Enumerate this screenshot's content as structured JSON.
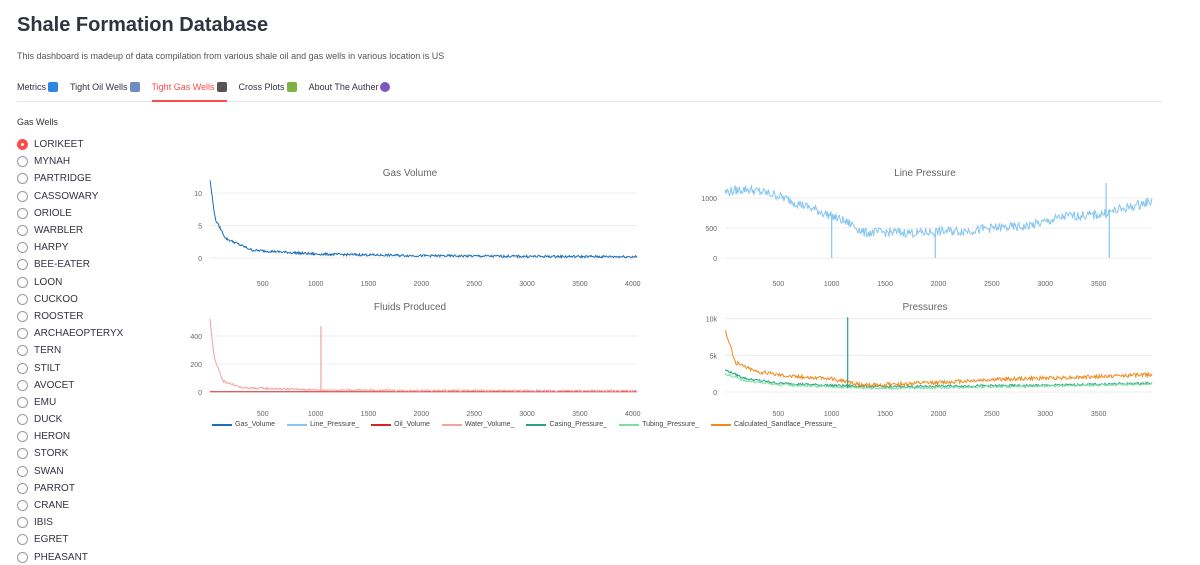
{
  "header": {
    "title": "Shale Formation Database",
    "description": "This dashboard is madeup of data compilation from various shale oil and gas wells in various location is US"
  },
  "tabs": [
    {
      "label": "Metrics",
      "icon": "chart-emoji-icon",
      "color": "#2e86de",
      "active": false
    },
    {
      "label": "Tight Oil Wells",
      "icon": "chart-down-emoji-icon",
      "color": "#6c8ebf",
      "active": false
    },
    {
      "label": "Tight Gas Wells",
      "icon": "calendar-emoji-icon",
      "color": "#555555",
      "active": true
    },
    {
      "label": "Cross Plots",
      "icon": "map-emoji-icon",
      "color": "#7cb342",
      "active": false
    },
    {
      "label": "About The Auther",
      "icon": "globe-emoji-icon",
      "color": "#7e57c2",
      "active": false
    }
  ],
  "wells": {
    "label": "Gas Wells",
    "selected": "LORIKEET",
    "options": [
      "LORIKEET",
      "MYNAH",
      "PARTRIDGE",
      "CASSOWARY",
      "ORIOLE",
      "WARBLER",
      "HARPY",
      "BEE-EATER",
      "LOON",
      "CUCKOO",
      "ROOSTER",
      "ARCHAEOPTERYX",
      "TERN",
      "STILT",
      "AVOCET",
      "EMU",
      "DUCK",
      "HERON",
      "STORK",
      "SWAN",
      "PARROT",
      "CRANE",
      "IBIS",
      "EGRET",
      "PHEASANT"
    ]
  },
  "chart_data": [
    {
      "type": "line",
      "title": "Gas Volume",
      "xlim": [
        1,
        4040
      ],
      "ylim": [
        0,
        12
      ],
      "xticks": [
        500,
        1000,
        1500,
        2000,
        2500,
        3000,
        3500,
        4000
      ],
      "yticks": [
        0,
        5,
        10
      ],
      "series": [
        {
          "name": "Gas_Volume",
          "color": "#1f6fb5",
          "shape": "decay",
          "values": [
            [
              1,
              12
            ],
            [
              50,
              6
            ],
            [
              150,
              3
            ],
            [
              400,
              1.2
            ],
            [
              1000,
              0.6
            ],
            [
              2000,
              0.35
            ],
            [
              3000,
              0.25
            ],
            [
              4040,
              0.2
            ]
          ]
        }
      ]
    },
    {
      "type": "line",
      "title": "Line Pressure",
      "xlim": [
        1,
        4000
      ],
      "ylim": [
        0,
        1300
      ],
      "xticks": [
        500,
        1000,
        1500,
        2000,
        2500,
        3000,
        3500
      ],
      "yticks": [
        0,
        500,
        1000
      ],
      "series": [
        {
          "name": "Line_Pressure_",
          "color": "#86c5f0",
          "values": [
            [
              1,
              1100
            ],
            [
              200,
              1150
            ],
            [
              480,
              1050
            ],
            [
              700,
              900
            ],
            [
              850,
              800
            ],
            [
              1000,
              700
            ],
            [
              1200,
              550
            ],
            [
              1300,
              420
            ],
            [
              1500,
              430
            ],
            [
              1800,
              420
            ],
            [
              2000,
              440
            ],
            [
              2300,
              460
            ],
            [
              2500,
              500
            ],
            [
              2800,
              520
            ],
            [
              3000,
              600
            ],
            [
              3200,
              700
            ],
            [
              3500,
              720
            ],
            [
              3800,
              850
            ],
            [
              4000,
              950
            ]
          ]
        }
      ]
    },
    {
      "type": "line",
      "title": "Fluids Produced",
      "xlim": [
        1,
        4040
      ],
      "ylim": [
        0,
        550
      ],
      "xticks": [
        500,
        1000,
        1500,
        2000,
        2500,
        3000,
        3500,
        4000
      ],
      "yticks": [
        0,
        200,
        400
      ],
      "series": [
        {
          "name": "Oil_Volume",
          "color": "#d62728",
          "values": [
            [
              1,
              2
            ],
            [
              4040,
              2
            ]
          ]
        },
        {
          "name": "Water_Volume_",
          "color": "#f4a3a3",
          "values": [
            [
              1,
              520
            ],
            [
              40,
              250
            ],
            [
              120,
              80
            ],
            [
              300,
              30
            ],
            [
              1000,
              15
            ],
            [
              2000,
              10
            ],
            [
              4040,
              8
            ]
          ]
        }
      ]
    },
    {
      "type": "line",
      "title": "Pressures",
      "xlim": [
        1,
        4000
      ],
      "ylim": [
        0,
        10500
      ],
      "xticks": [
        500,
        1000,
        1500,
        2000,
        2500,
        3000,
        3500
      ],
      "yticks": [
        0,
        5000,
        10000
      ],
      "ytick_labels": [
        "0",
        "5k",
        "10k"
      ],
      "series": [
        {
          "name": "Casing_Pressure_",
          "color": "#2ca089",
          "values": [
            [
              1,
              3000
            ],
            [
              200,
              1800
            ],
            [
              500,
              1200
            ],
            [
              1000,
              900
            ],
            [
              1500,
              700
            ],
            [
              2000,
              800
            ],
            [
              3000,
              900
            ],
            [
              4000,
              1200
            ]
          ]
        },
        {
          "name": "Tubing_Pressure_",
          "color": "#7ee0a0",
          "values": [
            [
              1,
              2500
            ],
            [
              200,
              1500
            ],
            [
              500,
              1000
            ],
            [
              1000,
              700
            ],
            [
              1500,
              500
            ],
            [
              2000,
              600
            ],
            [
              3000,
              800
            ],
            [
              4000,
              1100
            ]
          ]
        },
        {
          "name": "Calculated_Sandface_Pressure_",
          "color": "#f08a1c",
          "values": [
            [
              1,
              8500
            ],
            [
              100,
              4000
            ],
            [
              300,
              2800
            ],
            [
              600,
              2200
            ],
            [
              1000,
              1800
            ],
            [
              1300,
              900
            ],
            [
              2000,
              1300
            ],
            [
              2500,
              1700
            ],
            [
              3000,
              1900
            ],
            [
              3500,
              2100
            ],
            [
              4000,
              2400
            ]
          ]
        }
      ]
    }
  ],
  "legend": [
    {
      "name": "Gas_Volume",
      "color": "#1f6fb5"
    },
    {
      "name": "Line_Pressure_",
      "color": "#86c5f0"
    },
    {
      "name": "Oil_Volume",
      "color": "#d62728"
    },
    {
      "name": "Water_Volume_",
      "color": "#f4a3a3"
    },
    {
      "name": "Casing_Pressure_",
      "color": "#2ca089"
    },
    {
      "name": "Tubing_Pressure_",
      "color": "#7ee0a0"
    },
    {
      "name": "Calculated_Sandface_Pressure_",
      "color": "#f08a1c"
    }
  ]
}
